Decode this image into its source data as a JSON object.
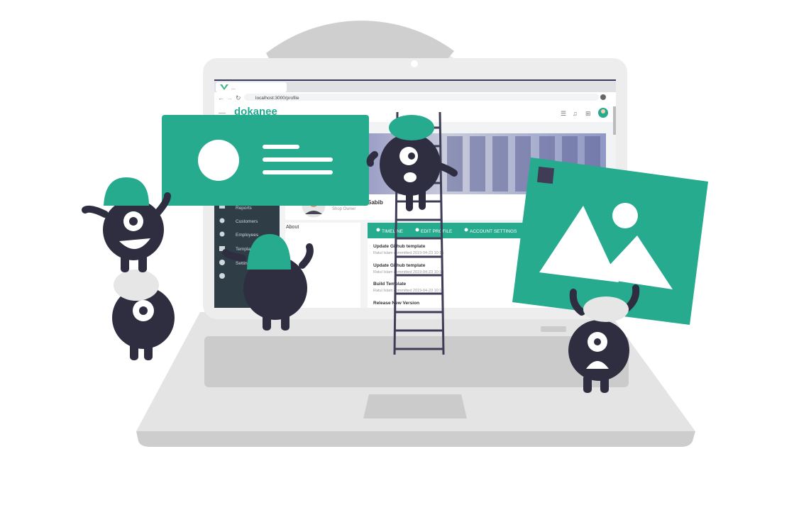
{
  "colors": {
    "accent": "#26ab8f",
    "monster": "#2f2e41",
    "laptop_body": "#e4e4e4",
    "laptop_dark": "#cfcfcf",
    "circle_bg": "#e7e7e7",
    "sidebar": "#2f3d47"
  },
  "app": {
    "logo": "dokanee",
    "url": "localhost:3000/profile",
    "tab_title": "..."
  },
  "sidebar": {
    "items": [
      {
        "label": "Reports",
        "icon": "chart-icon"
      },
      {
        "label": "Customers",
        "icon": "users-icon"
      },
      {
        "label": "Employees",
        "icon": "users-icon"
      },
      {
        "label": "Templates",
        "icon": "template-icon"
      },
      {
        "label": "Settings",
        "icon": "gear-icon"
      },
      {
        "label": "",
        "icon": "compass-icon"
      }
    ]
  },
  "profile": {
    "name": "Sabib",
    "role": "Shop Owner",
    "about_label": "About"
  },
  "tabs": [
    {
      "label": "TIMELINE",
      "icon": "user-icon"
    },
    {
      "label": "EDIT PROFILE",
      "icon": "user-edit-icon"
    },
    {
      "label": "ACCOUNT SETTINGS",
      "icon": "user-cog-icon"
    }
  ],
  "timeline": [
    {
      "title": "Update Github template",
      "meta": "Ratul Islam committed 2019-04-23 10:15"
    },
    {
      "title": "Update Github template",
      "meta": "Ratul Islam committed 2019-04-23 10:15"
    },
    {
      "title": "Build Template",
      "meta": "Ratul Islam committed 2019-04-23 10:15"
    },
    {
      "title": "Release New Version",
      "meta": ""
    }
  ]
}
